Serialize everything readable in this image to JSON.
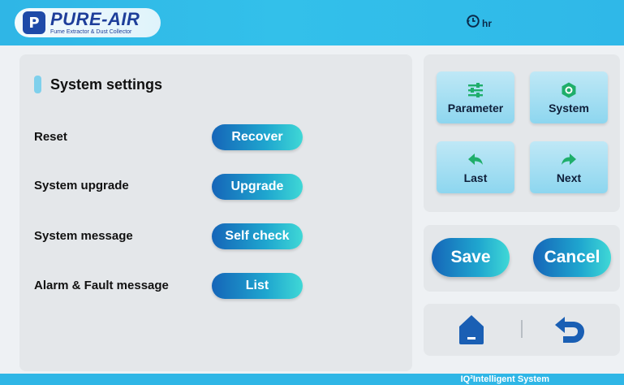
{
  "header": {
    "logo_mark": "P",
    "logo_name": "PURE-AIR",
    "logo_tagline": "Fume Extractor & Dust Collector",
    "hour_unit": "hr"
  },
  "settings": {
    "title": "System settings",
    "rows": [
      {
        "label": "Reset",
        "button": "Recover"
      },
      {
        "label": "System upgrade",
        "button": "Upgrade"
      },
      {
        "label": "System message",
        "button": "Self check"
      },
      {
        "label": "Alarm & Fault message",
        "button": "List"
      }
    ]
  },
  "nav": {
    "parameter": "Parameter",
    "system": "System",
    "last": "Last",
    "next": "Next"
  },
  "actions": {
    "save": "Save",
    "cancel": "Cancel"
  },
  "footer": {
    "text": "IQ²Intelligent System"
  },
  "colors": {
    "header": "#2fb6e6",
    "accent_green": "#1fae6a",
    "nav_blue": "#1a5fb4",
    "button_gradient_start": "#1565b8",
    "button_gradient_end": "#3fd8d6"
  },
  "icons": [
    "sliders-icon",
    "hexagon-icon",
    "arrow-left-icon",
    "arrow-right-icon",
    "home-icon",
    "undo-icon",
    "clock-icon"
  ]
}
